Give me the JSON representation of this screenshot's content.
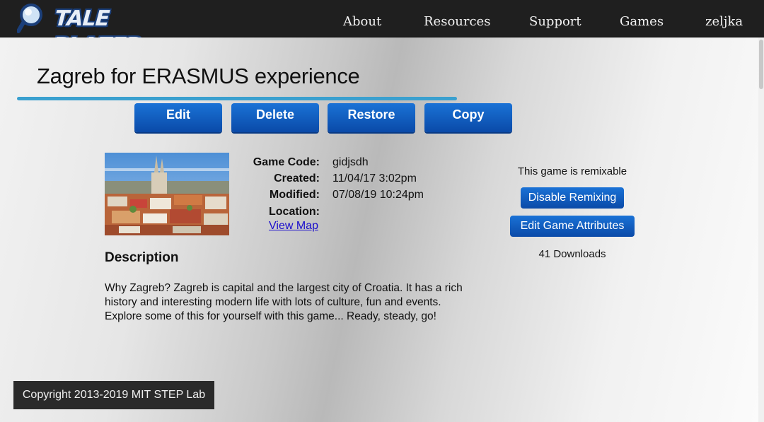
{
  "brand": {
    "logo_text": "TALE BLAZER"
  },
  "nav": {
    "items": [
      {
        "label": "About"
      },
      {
        "label": "Resources"
      },
      {
        "label": "Support"
      },
      {
        "label": "Games"
      },
      {
        "label": "zeljka"
      }
    ]
  },
  "page": {
    "title": "Zagreb for ERASMUS experience"
  },
  "actions": {
    "edit": "Edit",
    "delete": "Delete",
    "restore": "Restore",
    "copy": "Copy"
  },
  "game_info": {
    "code_label": "Game Code:",
    "code_value": "gidjsdh",
    "created_label": "Created:",
    "created_value": "11/04/17 3:02pm",
    "modified_label": "Modified:",
    "modified_value": "07/08/19 10:24pm",
    "location_label": "Location:",
    "view_map": "View Map"
  },
  "remix": {
    "status": "This game is remixable",
    "disable_button": "Disable Remixing",
    "edit_attributes_button": "Edit Game Attributes",
    "downloads": "41 Downloads"
  },
  "description": {
    "heading": "Description",
    "body": "Why Zagreb? Zagreb is capital and the largest city of Croatia. It has a rich history and interesting modern life with lots of culture, fun and events. Explore some of this for yourself with this game... Ready, steady, go!"
  },
  "footer": {
    "copyright": "Copyright 2013-2019 MIT STEP Lab"
  },
  "colors": {
    "topbar": "#1f1f1f",
    "button_blue": "#0a4aa8",
    "underline": "#3aa0cf",
    "link": "#1a0dcc"
  }
}
